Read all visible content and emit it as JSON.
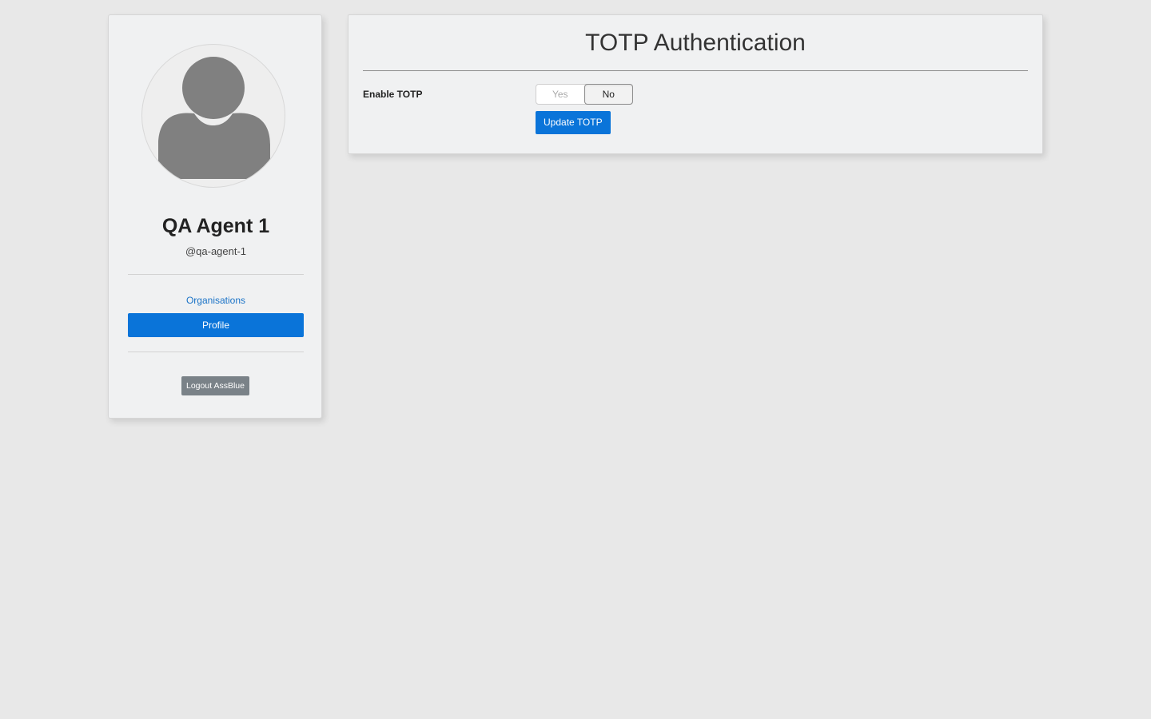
{
  "sidebar": {
    "avatar_icon": "user-silhouette-icon",
    "user_name": "QA Agent 1",
    "user_handle": "@qa-agent-1",
    "nav": {
      "organisations_label": "Organisations",
      "profile_label": "Profile",
      "active_item": "Profile"
    },
    "logout_label": "Logout AssBlue"
  },
  "main": {
    "title": "TOTP Authentication",
    "enable_totp": {
      "label": "Enable TOTP",
      "options": [
        "Yes",
        "No"
      ],
      "selected": "No"
    },
    "update_button_label": "Update TOTP"
  },
  "colors": {
    "background": "#e8e8e8",
    "card": "#f0f1f2",
    "accent": "#0a74d9",
    "link": "#1a73c7",
    "logout_button": "#7a8288",
    "avatar_fill": "#808080"
  }
}
